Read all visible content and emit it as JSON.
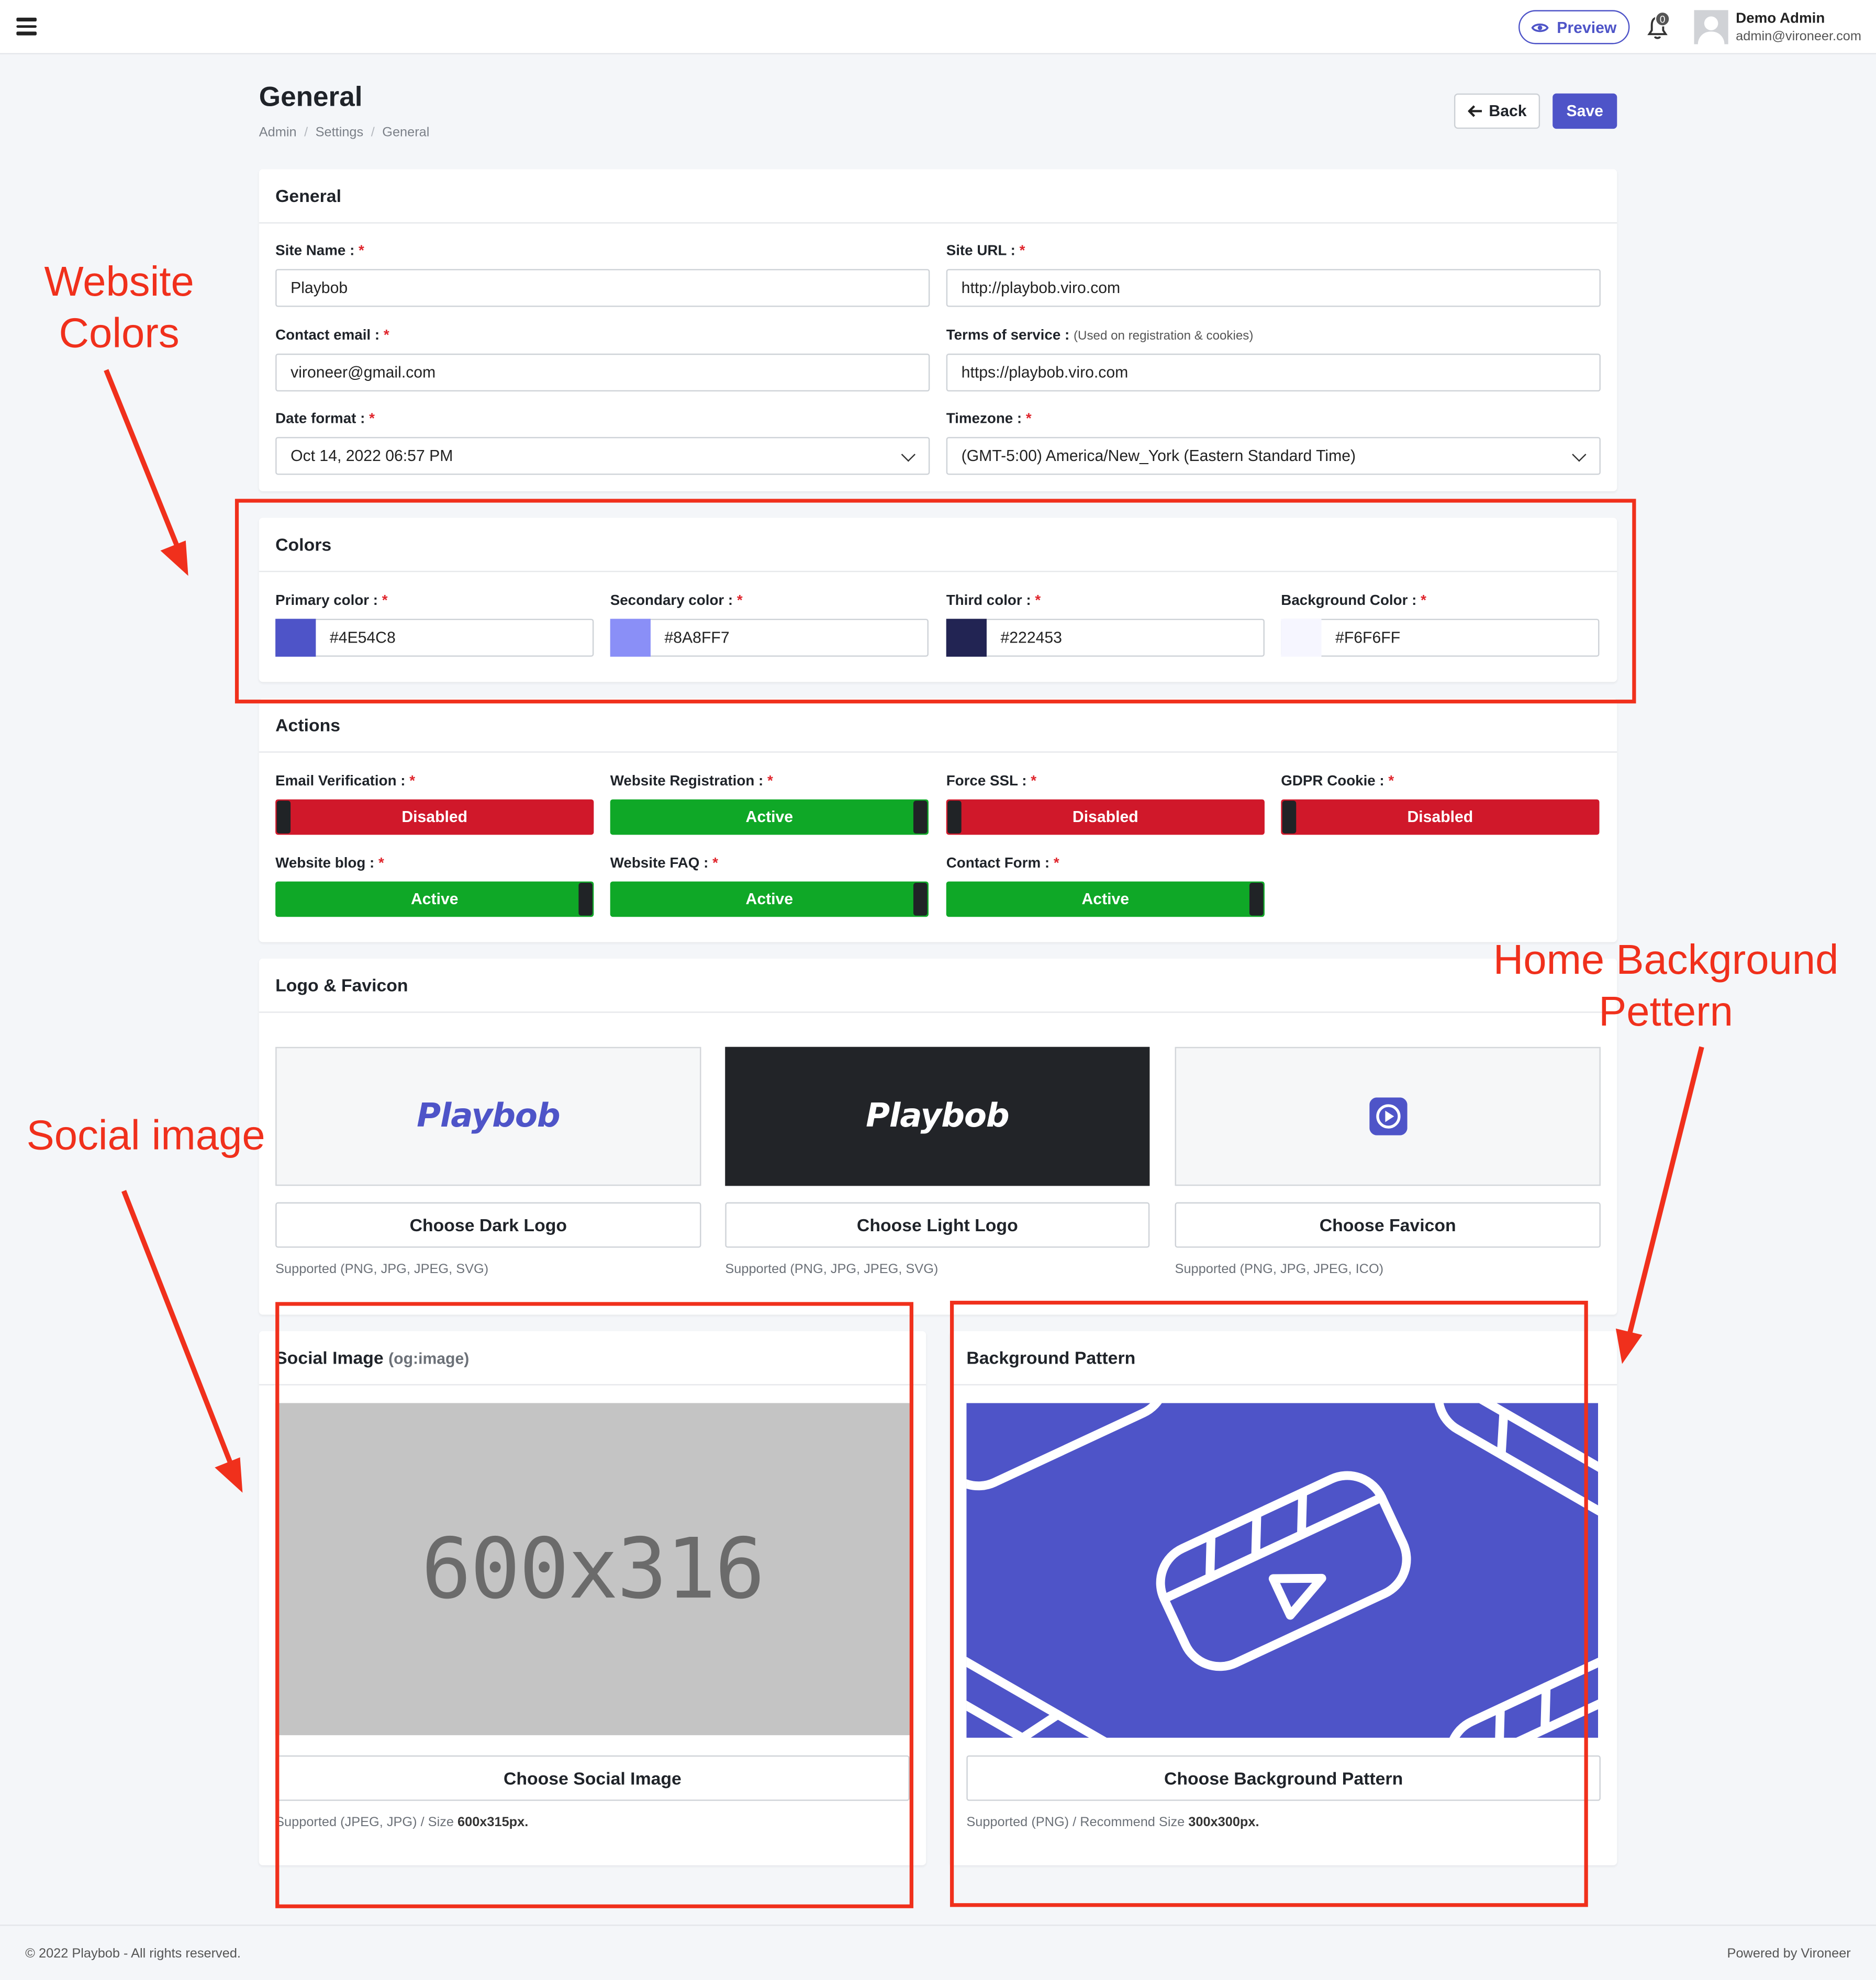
{
  "topbar": {
    "preview_label": "Preview",
    "notification_count": "0",
    "user_name": "Demo Admin",
    "user_email": "admin@vironeer.com"
  },
  "header": {
    "title": "General",
    "breadcrumb": [
      "Admin",
      "Settings",
      "General"
    ],
    "back_label": "Back",
    "save_label": "Save"
  },
  "general": {
    "title": "General",
    "site_name_label": "Site Name :",
    "site_name_value": "Playbob",
    "site_url_label": "Site URL :",
    "site_url_value": "http://playbob.viro.com",
    "contact_email_label": "Contact email :",
    "contact_email_value": "vironeer@gmail.com",
    "terms_label": "Terms of service :",
    "terms_hint": "(Used on registration & cookies)",
    "terms_value": "https://playbob.viro.com",
    "date_format_label": "Date format :",
    "date_format_value": "Oct 14, 2022 06:57 PM",
    "timezone_label": "Timezone :",
    "timezone_value": "(GMT-5:00) America/New_York (Eastern Standard Time)"
  },
  "colors": {
    "title": "Colors",
    "items": [
      {
        "label": "Primary color :",
        "value": "#4E54C8",
        "swatch": "#4E54C8"
      },
      {
        "label": "Secondary color :",
        "value": "#8A8FF7",
        "swatch": "#8A8FF7"
      },
      {
        "label": "Third color :",
        "value": "#222453",
        "swatch": "#222453"
      },
      {
        "label": "Background Color :",
        "value": "#F6F6FF",
        "swatch": "#F6F6FF"
      }
    ]
  },
  "actions": {
    "title": "Actions",
    "items": [
      {
        "label": "Email Verification :",
        "state": "Disabled"
      },
      {
        "label": "Website Registration :",
        "state": "Active"
      },
      {
        "label": "Force SSL :",
        "state": "Disabled"
      },
      {
        "label": "GDPR Cookie :",
        "state": "Disabled"
      },
      {
        "label": "Website blog :",
        "state": "Active"
      },
      {
        "label": "Website FAQ :",
        "state": "Active"
      },
      {
        "label": "Contact Form :",
        "state": "Active"
      }
    ]
  },
  "logo_favicon": {
    "title": "Logo & Favicon",
    "dark_logo_text": "Playbob",
    "light_logo_text": "Playbob",
    "dark_logo_button": "Choose Dark Logo",
    "light_logo_button": "Choose Light Logo",
    "favicon_button": "Choose Favicon",
    "dark_logo_supported": "Supported (PNG, JPG, JPEG, SVG)",
    "light_logo_supported": "Supported (PNG, JPG, JPEG, SVG)",
    "favicon_supported": "Supported (PNG, JPG, JPEG, ICO)"
  },
  "social_image": {
    "title": "Social Image",
    "title_hint": "(og:image)",
    "placeholder_text": "600x316",
    "button": "Choose Social Image",
    "supported_prefix": "Supported (JPEG, JPG) / Size ",
    "supported_size": "600x315px."
  },
  "background_pattern": {
    "title": "Background Pattern",
    "button": "Choose Background Pattern",
    "supported_prefix": "Supported (PNG) / Recommend Size ",
    "supported_size": "300x300px.",
    "pattern_color": "#4E54C8"
  },
  "footer": {
    "copyright": "© 2022 Playbob - All rights reserved.",
    "powered": "Powered by Vironeer"
  },
  "annotations": {
    "website_colors": [
      "Website",
      "Colors"
    ],
    "social_image": "Social image",
    "home_background": [
      "Home Background",
      "Pettern"
    ],
    "color": "#F0301C"
  },
  "colors_theme": {
    "accent": "#4E54C8",
    "toggle_on": "#0FA827",
    "toggle_off": "#D0182A"
  }
}
